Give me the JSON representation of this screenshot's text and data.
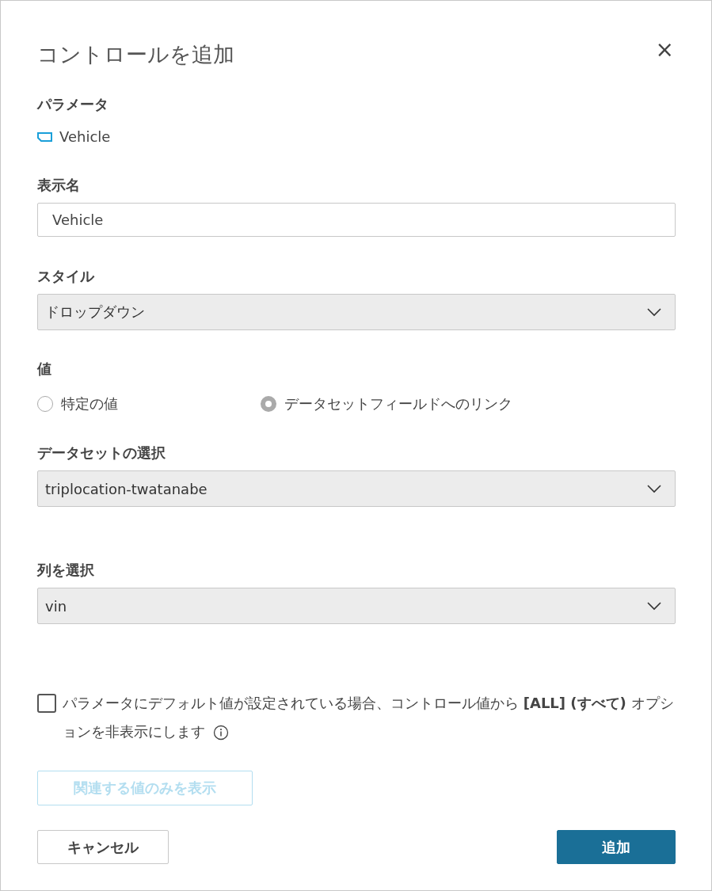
{
  "dialog": {
    "title": "コントロールを追加",
    "close": "×"
  },
  "parameter": {
    "label": "パラメータ",
    "name": "Vehicle"
  },
  "display_name": {
    "label": "表示名",
    "value": "Vehicle"
  },
  "style": {
    "label": "スタイル",
    "value": "ドロップダウン"
  },
  "values": {
    "label": "値",
    "options": [
      {
        "label": "特定の値",
        "selected": false
      },
      {
        "label": "データセットフィールドへのリンク",
        "selected": true
      }
    ]
  },
  "dataset": {
    "label": "データセットの選択",
    "value": "triplocation-twatanabe"
  },
  "column": {
    "label": "列を選択",
    "value": "vin"
  },
  "hide_all": {
    "label": "パラメータにデフォルト値が設定されている場合、コントロール値から **[ALL] (すべて)** オプションを非表示にします",
    "checked": false
  },
  "related_button": {
    "label": "関連する値のみを表示",
    "disabled": true
  },
  "buttons": [
    {
      "label": "キャンセル",
      "kind": "secondary"
    },
    {
      "label": "追加",
      "kind": "primary"
    }
  ]
}
